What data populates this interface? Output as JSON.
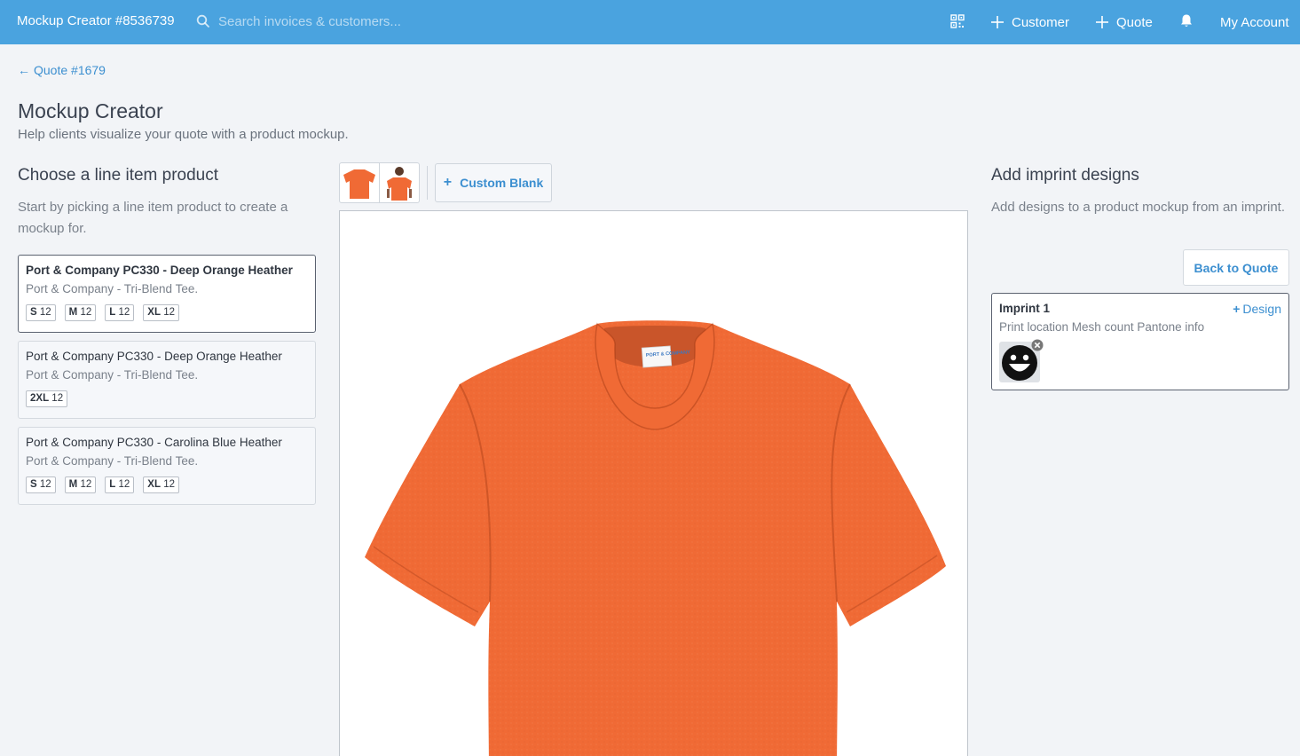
{
  "topbar": {
    "app_title": "Mockup Creator #8536739",
    "search_placeholder": "Search invoices & customers...",
    "customer_label": "Customer",
    "quote_label": "Quote",
    "account_label": "My Account"
  },
  "header": {
    "back_link": "Quote #1679",
    "title": "Mockup Creator",
    "subtitle": "Help clients visualize your quote with a product mockup."
  },
  "left": {
    "title": "Choose a line item product",
    "description": "Start by picking a line item product to create a mockup for.",
    "products": [
      {
        "name": "Port & Company PC330 - Deep Orange Heather",
        "subtitle": "Port & Company - Tri-Blend Tee.",
        "selected": true,
        "sizes": [
          {
            "size": "S",
            "qty": "12"
          },
          {
            "size": "M",
            "qty": "12"
          },
          {
            "size": "L",
            "qty": "12"
          },
          {
            "size": "XL",
            "qty": "12"
          }
        ]
      },
      {
        "name": "Port & Company PC330 - Deep Orange Heather",
        "subtitle": "Port & Company - Tri-Blend Tee.",
        "selected": false,
        "sizes": [
          {
            "size": "2XL",
            "qty": "12"
          }
        ]
      },
      {
        "name": "Port & Company PC330 - Carolina Blue Heather",
        "subtitle": "Port & Company - Tri-Blend Tee.",
        "selected": false,
        "sizes": [
          {
            "size": "S",
            "qty": "12"
          },
          {
            "size": "M",
            "qty": "12"
          },
          {
            "size": "L",
            "qty": "12"
          },
          {
            "size": "XL",
            "qty": "12"
          }
        ]
      }
    ]
  },
  "center": {
    "custom_blank_label": "Custom Blank",
    "shirt_color": "#f06a35",
    "tag_text": "PORT & COMPANY"
  },
  "right": {
    "title": "Add imprint designs",
    "description": "Add designs to a product mockup from an imprint.",
    "back_to_quote": "Back to Quote",
    "imprint": {
      "title": "Imprint 1",
      "design_label": "Design",
      "info": "Print location Mesh count Pantone info"
    }
  },
  "colors": {
    "topbar": "#4aa3df",
    "accent": "#3c8fd0",
    "background": "#f2f4f7"
  }
}
